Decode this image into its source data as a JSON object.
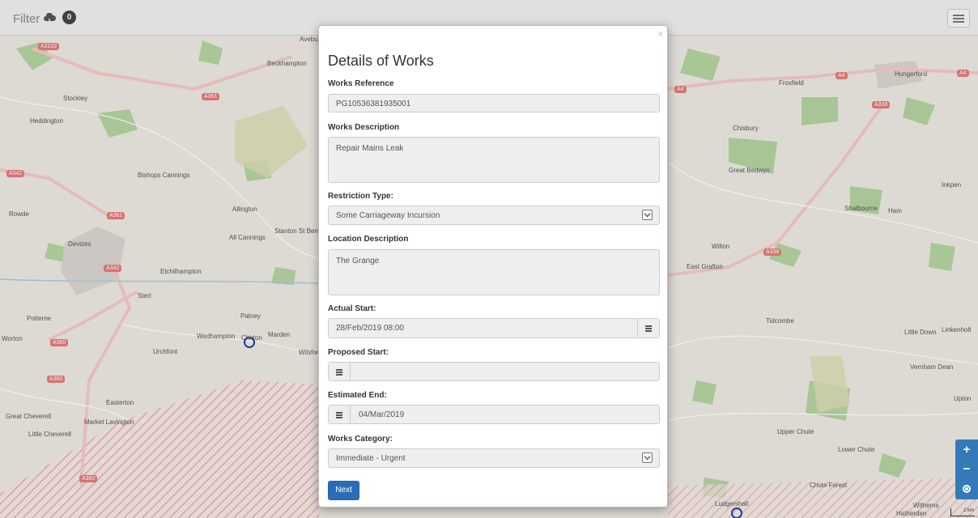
{
  "topbar": {
    "filter_label": "Filter",
    "filter_count": "0"
  },
  "map": {
    "places": [
      "Avebury",
      "Beckhampton",
      "Stockley",
      "Heddington",
      "Bishops Cannings",
      "Rowde",
      "Allington",
      "All Cannings",
      "Stanton St Bernard",
      "Devizes",
      "Etchilhampton",
      "Stert",
      "Potterne",
      "Patney",
      "Wedhampton",
      "Chirton",
      "Marden",
      "Wilsford",
      "Urchfont",
      "Worton",
      "Easterton",
      "Great Cheverell",
      "Market Lavington",
      "Little Cheverell",
      "Froxfield",
      "Hungerford",
      "Chisbury",
      "Great Bedwyn",
      "Inkpen",
      "Shalbourne",
      "Ham",
      "Wilton",
      "East Grafton",
      "Tidcombe",
      "Little Down",
      "Linkenholt",
      "Vernham Dean",
      "Upton",
      "Upper Chute",
      "Lower Chute",
      "Chute Forest",
      "Ludgershall",
      "Hatherden",
      "Witherns"
    ],
    "roads": [
      "A3102",
      "A361",
      "A342",
      "A361",
      "A342",
      "A360",
      "A360",
      "A360",
      "A4",
      "A4",
      "A338",
      "A338",
      "A4"
    ],
    "scale_label": "2 km"
  },
  "modal": {
    "close_glyph": "×",
    "title": "Details of Works",
    "works_reference": {
      "label": "Works Reference",
      "value": "PG10536381935001"
    },
    "works_description": {
      "label": "Works Description",
      "value": "Repair Mains Leak"
    },
    "restriction_type": {
      "label": "Restriction Type:",
      "value": "Some Carriageway Incursion"
    },
    "location_description": {
      "label": "Location Description",
      "value": "The Grange"
    },
    "actual_start": {
      "label": "Actual Start:",
      "value": "28/Feb/2019 08:00"
    },
    "proposed_start": {
      "label": "Proposed Start:",
      "value": ""
    },
    "estimated_end": {
      "label": "Estimated End:",
      "value": "04/Mar/2019"
    },
    "works_category": {
      "label": "Works Category:",
      "value": "Immediate - Urgent"
    },
    "next_label": "Next"
  },
  "zoom": {
    "in": "+",
    "out": "−"
  },
  "colors": {
    "accent": "#337ab7",
    "button": "#2a6db6",
    "road": "#e47a78",
    "restricted": "#e8a0a0"
  },
  "icons": [
    "cloud-filter-icon",
    "hamburger-menu-icon",
    "calendar-icon",
    "select-chevron-icon",
    "locate-icon",
    "close-icon"
  ]
}
